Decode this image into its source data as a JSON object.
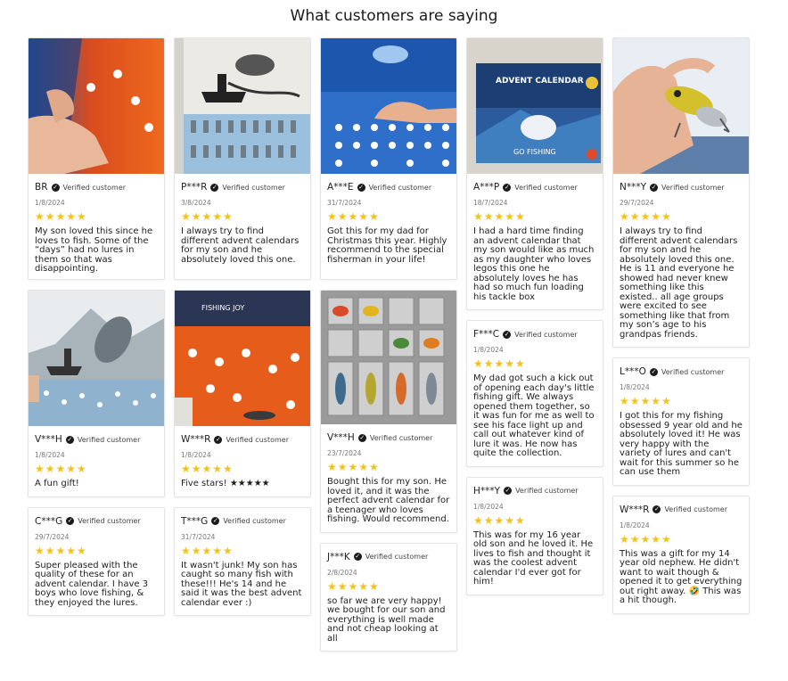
{
  "page_title": "What customers are saying",
  "verified_label": "Verified customer",
  "star_glyphs": "★★★★★",
  "colors": {
    "star": "#f2c318",
    "border": "#e4e4e4",
    "verified_icon": "#1b1b1b"
  },
  "reviews": {
    "r1": {
      "name": "BR",
      "date": "1/8/2024",
      "rating": 5,
      "text": "My son loved this since he loves to fish. Some of the “days” had no lures in them so that was disappointing."
    },
    "r2": {
      "name": "P***R",
      "date": "3/8/2024",
      "rating": 5,
      "text": "I always try to find different advent calendars for my son and he absolutely loved this one."
    },
    "r3": {
      "name": "A***E",
      "date": "31/7/2024",
      "rating": 5,
      "text": "Got this for my dad for Christmas this year. Highly recommend to the special fisherman in your life!"
    },
    "r4": {
      "name": "A***P",
      "date": "18/7/2024",
      "rating": 5,
      "text": "I had a hard time finding an advent calendar that my son would like as much as my daughter who loves legos this one he absolutely loves he has had so much fun loading his tackle box"
    },
    "r5": {
      "name": "N***Y",
      "date": "29/7/2024",
      "rating": 5,
      "text": "I always try to find different advent calendars for my son and he absolutely loved this one. He is 11 and everyone he showed had never knew something like this existed.. all age groups were excited to see something like that from my son’s age to his grandpas friends."
    },
    "r6": {
      "name": "V***H",
      "date": "1/8/2024",
      "rating": 5,
      "text": "A fun gift!"
    },
    "r7": {
      "name": "W***R",
      "date": "1/8/2024",
      "rating": 5,
      "text": "Five stars! ★★★★★"
    },
    "r8": {
      "name": "V***H",
      "date": "23/7/2024",
      "rating": 5,
      "text": "Bought this for my son. He loved it, and it was the perfect advent calendar for a teenager who loves fishing. Would recommend."
    },
    "r9": {
      "name": "F***C",
      "date": "1/8/2024",
      "rating": 5,
      "text": "My dad got such a kick out of opening each day's little fishing gift. We always opened them together, so it was fun for me as well to see his face light up and call out whatever kind of lure it was. He now has quite the collection."
    },
    "r10": {
      "name": "L***O",
      "date": "1/8/2024",
      "rating": 5,
      "text": "I got this for my fishing obsessed 9 year old and he absolutely loved it! He was very happy with the variety of lures and can't wait for this summer so he can use them"
    },
    "r11": {
      "name": "C***G",
      "date": "29/7/2024",
      "rating": 5,
      "text": "Super pleased with the quality of these for an advent calendar. I have 3 boys who love fishing, & they enjoyed the lures."
    },
    "r12": {
      "name": "T***G",
      "date": "31/7/2024",
      "rating": 5,
      "text": "It wasn't junk! My son has caught so many fish with these!!! He's 14 and he said it was the best advent calendar ever :)"
    },
    "r13": {
      "name": "J***K",
      "date": "2/8/2024",
      "rating": 5,
      "text": "so far we are very happy! we bought for our son and everything is well made and not cheap looking at all"
    },
    "r14": {
      "name": "H***Y",
      "date": "1/8/2024",
      "rating": 5,
      "text": "This was for my 16 year old son and he loved it. He lives to fish and thought it was the coolest advent calendar I'd ever got for him!"
    },
    "r15": {
      "name": "W***R",
      "date": "1/8/2024",
      "rating": 5,
      "text": "This was a gift for my 14 year old nephew. He didn't want to wait though & opened it to get everything out right away. 🤣 This was a hit though."
    }
  },
  "photos": {
    "p1": {
      "caption": ""
    },
    "p4": {
      "box_text": "ADVENT CALENDAR",
      "box_sub": "GO FISHING"
    },
    "p7": {
      "box_text": "FISHING JOY"
    }
  }
}
